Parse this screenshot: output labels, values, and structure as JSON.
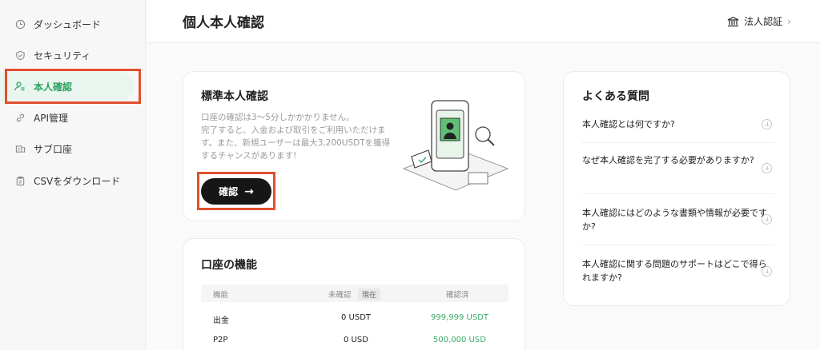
{
  "sidebar": {
    "items": [
      {
        "label": "ダッシュボード",
        "icon": "clock-icon"
      },
      {
        "label": "セキュリティ",
        "icon": "shield-icon"
      },
      {
        "label": "本人確認",
        "icon": "user-check-icon",
        "active": true
      },
      {
        "label": "API管理",
        "icon": "link-icon"
      },
      {
        "label": "サブ口座",
        "icon": "accounts-icon"
      },
      {
        "label": "CSVをダウンロード",
        "icon": "clipboard-icon"
      }
    ]
  },
  "header": {
    "title": "個人本人確認",
    "corp_link": "法人認証"
  },
  "verify": {
    "title": "標準本人確認",
    "desc_line1": "口座の確認は3〜5分しかかかりません。",
    "desc_line2": "完了すると、入金および取引をご利用いただけます。また、新規ユーザーは最大3,200USDTを獲得するチャンスがあります!",
    "button": "確認"
  },
  "features": {
    "title": "口座の機能",
    "headers": {
      "feature": "機能",
      "unverified": "未確認",
      "now": "現在",
      "verified": "確認済"
    },
    "rows": [
      {
        "feature": "出金",
        "unverified": "0 USDT",
        "verified": "999,999 USDT"
      },
      {
        "feature": "P2P",
        "unverified": "0 USD",
        "verified": "500,000 USD"
      }
    ]
  },
  "faq": {
    "title": "よくある質問",
    "items": [
      "本人確認とは何ですか?",
      "なぜ本人確認を完了する必要がありますか?",
      "本人確認にはどのような書類や情報が必要ですか?",
      "本人確認に関する問題のサポートはどこで得られますか?"
    ]
  },
  "colors": {
    "accent": "#2da15f",
    "highlight": "#e04f2f",
    "button": "#161616"
  }
}
